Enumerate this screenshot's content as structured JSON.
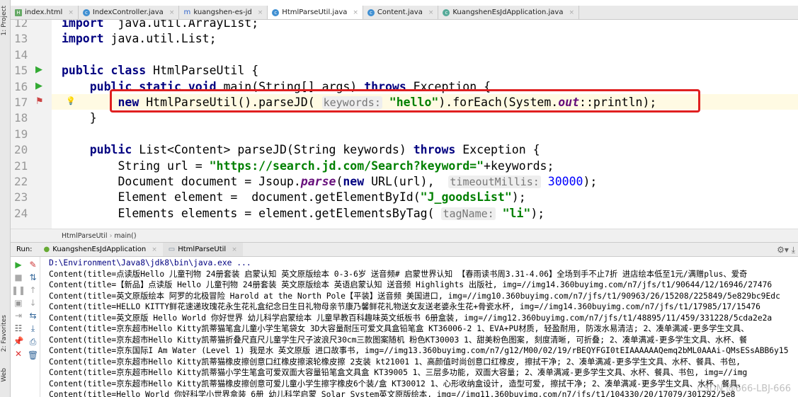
{
  "sidebar": {
    "project": "1: Project",
    "favorites": "2: Favorites",
    "web": "Web"
  },
  "tabs": [
    {
      "label": "index.html",
      "icon": "html-file-icon"
    },
    {
      "label": "IndexController.java",
      "icon": "class-icon"
    },
    {
      "label": "kuangshen-es-jd",
      "icon": "maven-icon"
    },
    {
      "label": "HtmlParseUtil.java",
      "icon": "class-icon",
      "active": true
    },
    {
      "label": "Content.java",
      "icon": "class-icon"
    },
    {
      "label": "KuangshenEsJdApplication.java",
      "icon": "spring-class-icon"
    }
  ],
  "code": [
    {
      "n": "12",
      "tokens": [
        [
          "kw",
          "import"
        ],
        [
          "",
          "  java.util.ArrayList;"
        ]
      ]
    },
    {
      "n": "13",
      "tokens": [
        [
          "kw",
          "import"
        ],
        [
          "",
          " java.util.List;"
        ]
      ]
    },
    {
      "n": "14",
      "tokens": []
    },
    {
      "n": "15",
      "tokens": [
        [
          "kw",
          "public class"
        ],
        [
          "",
          " HtmlParseUtil {"
        ]
      ]
    },
    {
      "n": "16",
      "tokens": [
        [
          "",
          "    "
        ],
        [
          "kw",
          "public static void"
        ],
        [
          "",
          " main(String[] args) "
        ],
        [
          "kw",
          "throws"
        ],
        [
          "",
          " Exception {"
        ]
      ]
    },
    {
      "n": "17",
      "tokens": [
        [
          "",
          "        "
        ],
        [
          "kw",
          "new"
        ],
        [
          "",
          " HtmlParseUtil().parseJD( "
        ],
        [
          "hint",
          "keywords:"
        ],
        [
          "",
          " "
        ],
        [
          "str",
          "\"hello\""
        ],
        [
          "",
          ").forEach(System."
        ],
        [
          "it",
          "out"
        ],
        [
          "",
          "::println);"
        ]
      ]
    },
    {
      "n": "18",
      "tokens": [
        [
          "",
          "    }"
        ]
      ]
    },
    {
      "n": "19",
      "tokens": []
    },
    {
      "n": "20",
      "tokens": [
        [
          "",
          "    "
        ],
        [
          "kw",
          "public"
        ],
        [
          "",
          " List<Content> parseJD(String keywords) "
        ],
        [
          "kw",
          "throws"
        ],
        [
          "",
          " Exception {"
        ]
      ]
    },
    {
      "n": "21",
      "tokens": [
        [
          "",
          "        String url = "
        ],
        [
          "str",
          "\"https://search.jd.com/Search?keyword=\""
        ],
        [
          "",
          "+keywords;"
        ]
      ]
    },
    {
      "n": "22",
      "tokens": [
        [
          "",
          "        Document document = Jsoup."
        ],
        [
          "it",
          "parse"
        ],
        [
          "",
          "("
        ],
        [
          "kw",
          "new"
        ],
        [
          "",
          " URL(url),  "
        ],
        [
          "hint",
          "timeoutMillis:"
        ],
        [
          "",
          " "
        ],
        [
          "num",
          "30000"
        ],
        [
          "",
          ");"
        ]
      ]
    },
    {
      "n": "23",
      "tokens": [
        [
          "",
          "        Element element =  document.getElementById("
        ],
        [
          "str",
          "\"J_goodsList\""
        ],
        [
          "",
          ");"
        ]
      ]
    },
    {
      "n": "24",
      "tokens": [
        [
          "",
          "        Elements elements = element.getElementsByTag( "
        ],
        [
          "hint",
          "tagName:"
        ],
        [
          "",
          " "
        ],
        [
          "str",
          "\"li\""
        ],
        [
          "",
          ");"
        ]
      ]
    }
  ],
  "breadcrumb": [
    "HtmlParseUtil",
    "main()"
  ],
  "run": {
    "label": "Run:",
    "tabs": [
      "KuangshenEsJdApplication",
      "HtmlParseUtil"
    ]
  },
  "console": [
    "D:\\Environment\\Java8\\jdk8\\bin\\java.exe ...",
    "Content(title=点读版Hello 儿童刊物 24册套装 启蒙认知 英文原版绘本 0-3-6岁 送音频# 启蒙世界认知 【春雨读书周3.31-4.06】全场到手不止7折 进店绘本低至1元/满赠plus、爱奇",
    "Content(title=【新品】点读版 Hello 儿童刊物 24册套装 英文原版绘本 英语启蒙认知 送音频 Highlights 出版社, img=//img14.360buyimg.com/n7/jfs/t1/90644/12/16946/27476",
    "Content(title=英文原版绘本 阿罗的北极冒险 Harold at the North Pole【平装】送音频 美国进口, img=//img10.360buyimg.com/n7/jfs/t1/90963/26/15208/225849/5e829bc9Edc",
    "Content(title=HELLO KITTY鲜花速递玫瑰花永生花礼盒纪念日生日礼物母亲节康乃馨鲜花礼物送女友送老婆永生花+骨瓷水杯, img=//img14.360buyimg.com/n7/jfs/t1/17985/17/15476",
    "Content(title=英文原版 Hello World 你好世界 幼儿科学启蒙绘本 儿童早教百科趣味英文纸板书 6册盒装, img=//img12.360buyimg.com/n7/jfs/t1/48895/11/459/331228/5cda2e2a",
    "Content(title=京东超市Hello Kitty凯蒂猫笔盒儿童小学生笔袋女 3D大容量耐压可爱文具盒铅笔盒 KT36006-2 1、EVA+PU材质, 轻盈耐用, 防泼水易清洁; 2、凑单满减-更多学生文具、",
    "Content(title=京东超市Hello Kitty凯蒂猫折叠尺直尺儿童学生尺子波浪尺30cm三款图案随机 粉色KT30003 1、甜美粉色图案, 刻度清晰, 可折叠; 2、凑单满减-更多学生文具、水杯、餐",
    "Content(title=京东国际I Am Water (Level 1) 我是水 英文原版 进口故事书, img=//img13.360buyimg.com/n7/g12/M00/02/19/rBEQYFGI0tEIAAAAAAQemq2bML0AAAi-QMsESsABB6y15",
    "Content(title=京东超市Hello Kitty凯蒂猫橡皮擦创意口红橡皮擦滚轮橡皮擦 2支装 kt21001 1、高颜值时尚创意口红橡皮, 擦拭干净; 2、凑单满减-更多学生文具、水杯、餐具、书包,",
    "Content(title=京东超市Hello Kitty凯蒂猫小学生笔盒可爱双面大容量铅笔盒文具盒 KT39005 1、三层多功能, 双面大容量; 2、凑单满减-更多学生文具、水杯、餐具、书包, img=//img",
    "Content(title=京东超市Hello Kitty凯蒂猫橡皮擦创意可爱儿童小学生擦字橡皮6个装/盒 KT30012 1、心形收纳盒设计, 造型可爱, 擦拭干净; 2、凑单满减-更多学生文具、水杯、餐具、",
    "Content(title=Hello World 你好科学小世界盒装 6册 幼儿科学启蒙 Solar System英文原版绘本, img=//img11.360buyimg.com/n7/jfs/t1/104330/20/17079/301292/5e8"
  ],
  "watermark": "CSDN @666-LBJ-666"
}
